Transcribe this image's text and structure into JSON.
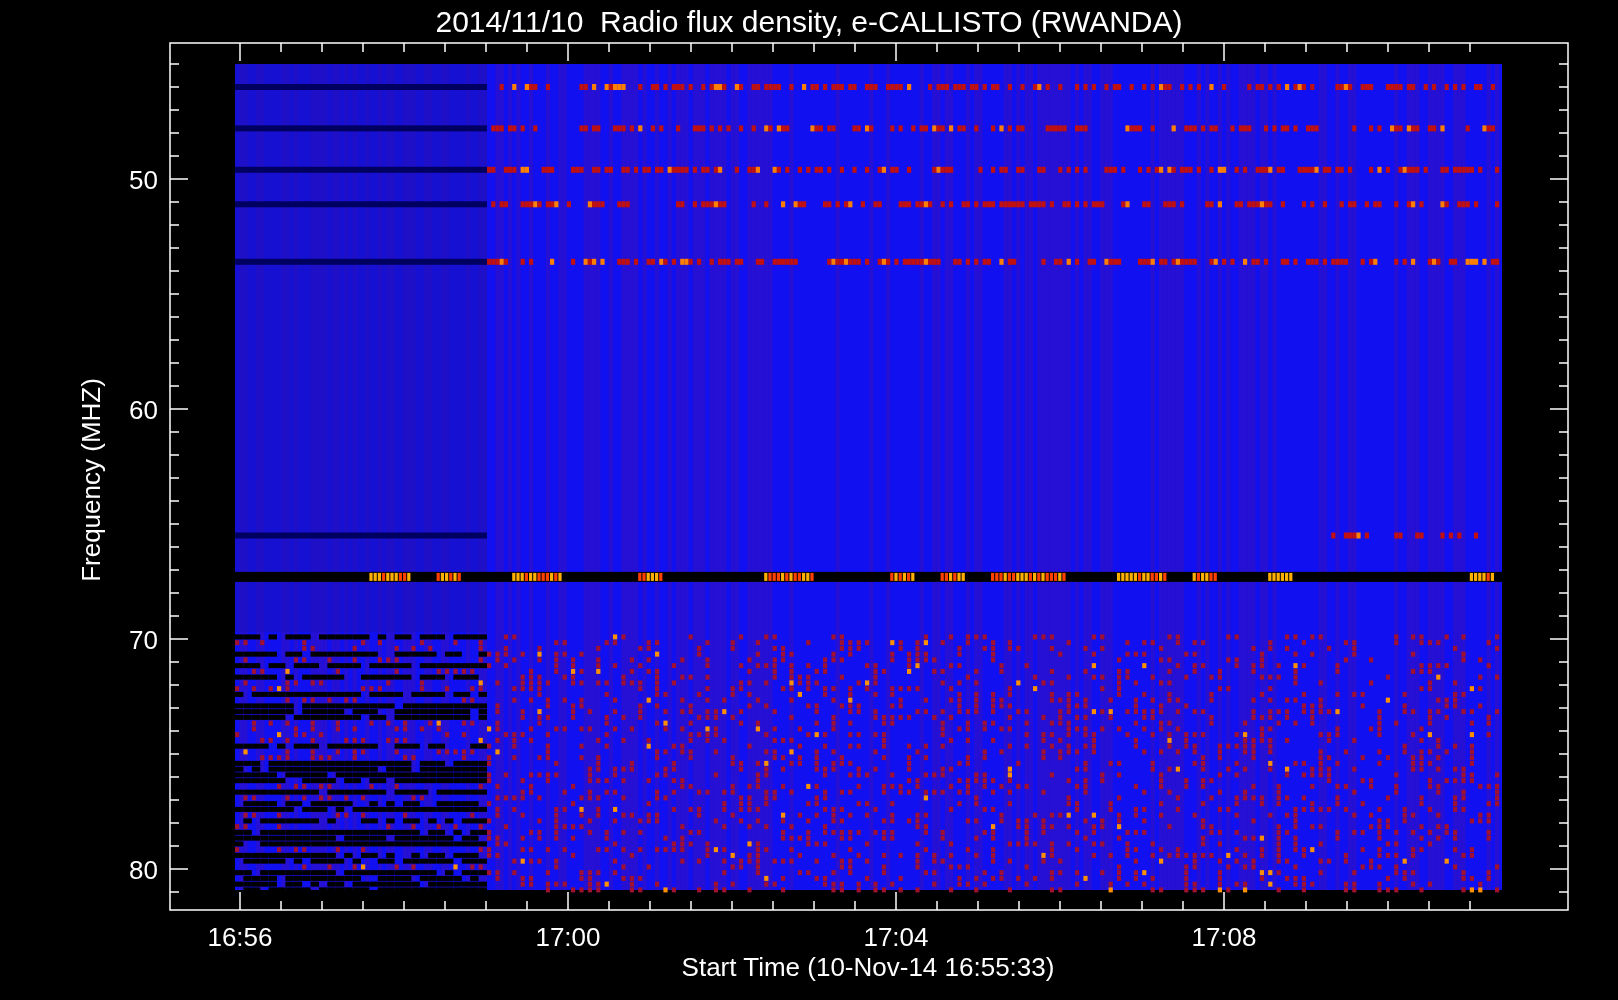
{
  "title": "2014/11/10  Radio flux density, e-CALLISTO (RWANDA)",
  "y_axis": {
    "label": "Frequency (MHZ)",
    "ticks": [
      "50",
      "60",
      "70",
      "80"
    ]
  },
  "x_axis": {
    "label": "Start Time (10-Nov-14 16:55:33)",
    "ticks": [
      "16:56",
      "17:00",
      "17:04",
      "17:08"
    ]
  }
}
